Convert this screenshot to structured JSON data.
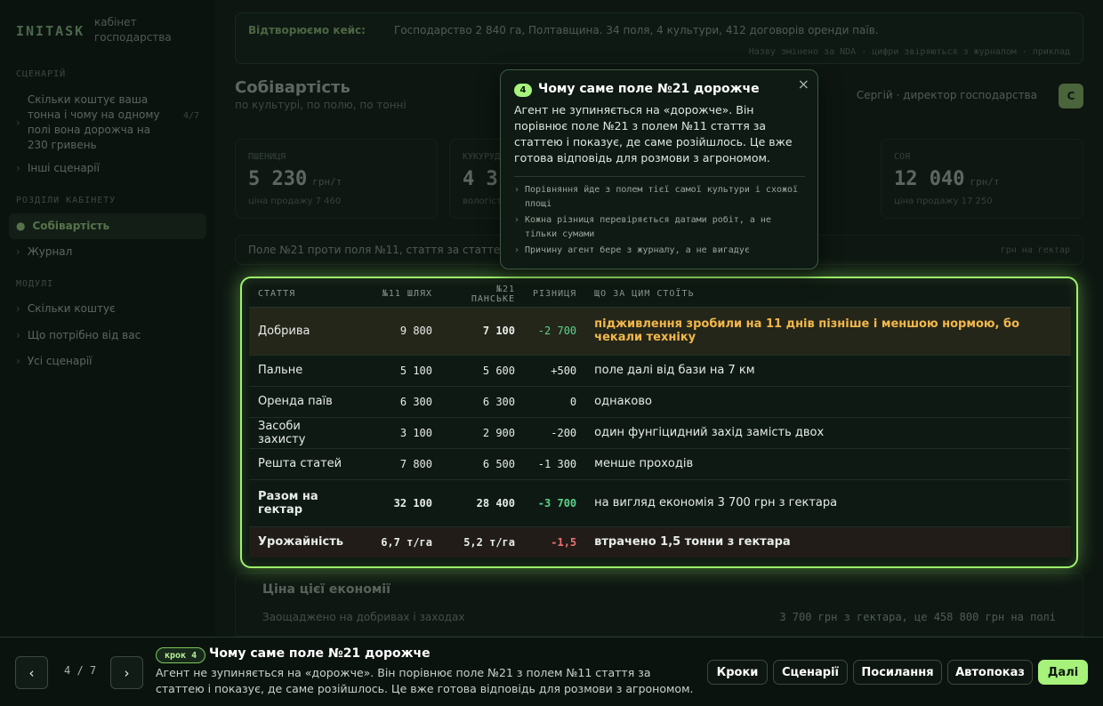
{
  "app": {
    "brand": "INITASK",
    "brand_sub_1": "кабінет",
    "brand_sub_2": "господарства"
  },
  "sidebar": {
    "section_scenario": "СЦЕНАРІЙ",
    "scenario_item": "Скільки коштує ваша тонна і чому на одному полі вона дорожча на 230 гривень",
    "scenario_count": "4/7",
    "other_scenarios": "Інші сценарії",
    "section_sections": "РОЗДІЛИ КАБІНЕТУ",
    "items": [
      {
        "label": "Собівартість"
      },
      {
        "label": "Журнал"
      }
    ],
    "section_modules": "МОДУЛІ",
    "modules": [
      {
        "label": "Скільки коштує"
      },
      {
        "label": "Що потрібно від вас"
      },
      {
        "label": "Усі сценарії"
      }
    ]
  },
  "header": {
    "scenario_label": "Відтворюємо кейс:",
    "scenario_value": "Господарство 2 840 га, Полтавщина. 34 поля, 4 культури, 412 договорів оренди паїв.",
    "meta": "Назву змінено за NDA · цифри звіряються з журналом · приклад",
    "title": "Собівартість",
    "subtitle": "по культурі, по полю, по тонні",
    "user": "Сергій · директор господарства",
    "avatar": "С"
  },
  "stats": [
    {
      "label": "ПШЕНИЦЯ",
      "value": "5 230",
      "unit": "грн/т",
      "note": "ціна продажу 7 460"
    },
    {
      "label": "КУКУРУДЗА",
      "value": "4 3",
      "unit": "",
      "note": "вологість"
    },
    {
      "label": "СОЯ",
      "value": "12 040",
      "unit": "грн/т",
      "note": "ціна продажу 17 250"
    }
  ],
  "compare": {
    "text": "Поле №21 проти поля №11, стаття за статтею",
    "right": "грн на гектар"
  },
  "table": {
    "headers": [
      "СТАТТЯ",
      "№11 ШЛЯХ",
      "№21 ПАНСЬКЕ",
      "РІЗНИЦЯ",
      "ЩО ЗА ЦИМ СТОЇТЬ"
    ],
    "rows": [
      {
        "item": "Добрива",
        "f11": "9 800",
        "f21": "7 100",
        "diff": "-2 700",
        "why": "підживлення зробили на 11 днів пізніше і меншою нормою, бо чекали техніку"
      },
      {
        "item": "Пальне",
        "f11": "5 100",
        "f21": "5 600",
        "diff": "+500",
        "why": "поле далі від бази на 7 км"
      },
      {
        "item": "Оренда паїв",
        "f11": "6 300",
        "f21": "6 300",
        "diff": "0",
        "why": "однаково"
      },
      {
        "item": "Засоби захисту",
        "f11": "3 100",
        "f21": "2 900",
        "diff": "-200",
        "why": "один фунгіцидний захід замість двох"
      },
      {
        "item": "Решта статей",
        "f11": "7 800",
        "f21": "6 500",
        "diff": "-1 300",
        "why": "менше проходів"
      },
      {
        "item": "Разом на гектар",
        "f11": "32 100",
        "f21": "28 400",
        "diff": "-3 700",
        "why": "на вигляд економія 3 700 грн з гектара"
      },
      {
        "item": "Урожайність",
        "f11": "6,7 т/га",
        "f21": "5,2 т/га",
        "diff": "-1,5",
        "why": "втрачено 1,5 тонни з гектара"
      }
    ]
  },
  "economy": {
    "title": "Ціна цієї економії",
    "left": "Заощаджено на добривах і заходах",
    "right": "3 700 грн з гектара, це 458 800 грн на полі"
  },
  "popover": {
    "step": "4",
    "title": "Чому саме поле №21 дорожче",
    "body": "Агент не зупиняється на «дорожче». Він порівнює поле №21 з полем №11 стаття за статтею і показує, де саме розійшлось. Це вже готова відповідь для розмови з агрономом.",
    "bullets": [
      "Порівняння йде з полем тієї самої культури і схожої площі",
      "Кожна різниця перевіряється датами робіт, а не тільки сумами",
      "Причину агент бере з журналу, а не вигадує"
    ],
    "close": "×"
  },
  "bottom": {
    "prev": "‹",
    "next": "›",
    "counter": "4 / 7",
    "step_badge": "крок 4",
    "title": "Чому саме поле №21 дорожче",
    "body": "Агент не зупиняється на «дорожче». Він порівнює поле №21 з полем №11 стаття за статтею і показує, де саме розійшлось. Це вже готова відповідь для розмови з агрономом.",
    "buttons": [
      "Кроки",
      "Сценарії",
      "Посилання",
      "Автопоказ",
      "Далі"
    ]
  },
  "colors": {
    "accent": "#a6f27a",
    "highlight_border": "#9df36b",
    "warning": "#f2b84b",
    "positive": "#58d38a",
    "negative": "#f07070"
  }
}
